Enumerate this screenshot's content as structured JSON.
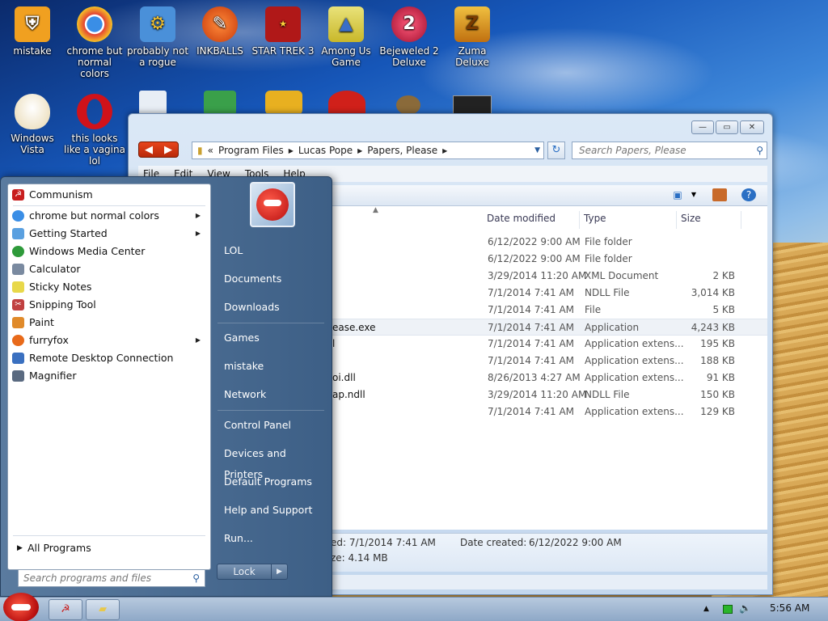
{
  "desktop": {
    "icons": [
      {
        "label": "mistake",
        "icon": "shield-folder-icon",
        "color": "#f0a020"
      },
      {
        "label": "chrome but normal colors",
        "icon": "chrome-icon",
        "color": "#3a8ee6"
      },
      {
        "label": "probably not a rogue",
        "icon": "gears-icon",
        "color": "#4a90d9"
      },
      {
        "label": "INKBALLS",
        "icon": "inkballs-icon",
        "color": "#e85a1a"
      },
      {
        "label": "STAR TREK 3",
        "icon": "star-wars-icon",
        "color": "#b01818"
      },
      {
        "label": "Among Us Game",
        "icon": "among-us-icon",
        "color": "#d9c22a"
      },
      {
        "label": "Bejeweled 2 Deluxe",
        "icon": "bejeweled-icon",
        "color": "#c81a3a"
      },
      {
        "label": "Zuma Deluxe",
        "icon": "zuma-icon",
        "color": "#e0a020"
      },
      {
        "label": "Windows Vista",
        "icon": "egg-icon",
        "color": "#f5f0e0"
      },
      {
        "label": "this looks like a vagina lol",
        "icon": "opera-icon",
        "color": "#d0121a"
      }
    ]
  },
  "explorer": {
    "breadcrumb": [
      "Program Files",
      "Lucas Pope",
      "Papers, Please"
    ],
    "breadcrumb_prefix": "«",
    "search_placeholder": "Search Papers, Please",
    "menu": [
      "File",
      "Edit",
      "View",
      "Tools",
      "Help"
    ],
    "columns": {
      "date": "Date modified",
      "type": "Type",
      "size": "Size"
    },
    "rows": [
      {
        "name": "",
        "date": "6/12/2022 9:00 AM",
        "type": "File folder",
        "size": ""
      },
      {
        "name": "",
        "date": "6/12/2022 9:00 AM",
        "type": "File folder",
        "size": ""
      },
      {
        "name": "",
        "date": "3/29/2014 11:20 AM",
        "type": "XML Document",
        "size": "2 KB"
      },
      {
        "name": "",
        "date": "7/1/2014 7:41 AM",
        "type": "NDLL File",
        "size": "3,014 KB"
      },
      {
        "name": "",
        "date": "7/1/2014 7:41 AM",
        "type": "File",
        "size": "5 KB"
      },
      {
        "name": "ease.exe",
        "date": "7/1/2014 7:41 AM",
        "type": "Application",
        "size": "4,243 KB"
      },
      {
        "name": "l",
        "date": "7/1/2014 7:41 AM",
        "type": "Application extens...",
        "size": "195 KB"
      },
      {
        "name": "",
        "date": "7/1/2014 7:41 AM",
        "type": "Application extens...",
        "size": "188 KB"
      },
      {
        "name": "oi.dll",
        "date": "8/26/2013 4:27 AM",
        "type": "Application extens...",
        "size": "91 KB"
      },
      {
        "name": "ap.ndll",
        "date": "3/29/2014 11:20 AM",
        "type": "NDLL File",
        "size": "150 KB"
      },
      {
        "name": "",
        "date": "7/1/2014 7:41 AM",
        "type": "Application extens...",
        "size": "129 KB"
      }
    ],
    "details": {
      "modified": "ed:  7/1/2014 7:41 AM",
      "created_label": "Date created:",
      "created_value": "6/12/2022 9:00 AM",
      "size": "ze:  4.14 MB"
    }
  },
  "start_menu": {
    "pinned": [
      {
        "label": "Communism",
        "color": "#c81e1e"
      }
    ],
    "programs": [
      {
        "label": "chrome but normal colors",
        "submenu": true,
        "color": "#3a8ee6"
      },
      {
        "label": "Getting Started",
        "submenu": true,
        "color": "#5aa0e0"
      },
      {
        "label": "Windows Media Center",
        "submenu": false,
        "color": "#2e9a3a"
      },
      {
        "label": "Calculator",
        "submenu": false,
        "color": "#7a8aa0"
      },
      {
        "label": "Sticky Notes",
        "submenu": false,
        "color": "#e8d84a"
      },
      {
        "label": "Snipping Tool",
        "submenu": false,
        "color": "#c04040"
      },
      {
        "label": "Paint",
        "submenu": false,
        "color": "#e08a2a"
      },
      {
        "label": "furryfox",
        "submenu": true,
        "color": "#e86a1a"
      },
      {
        "label": "Remote Desktop Connection",
        "submenu": false,
        "color": "#3a70c0"
      },
      {
        "label": "Magnifier",
        "submenu": false,
        "color": "#5a6a80"
      }
    ],
    "all_programs": "All Programs",
    "search_placeholder": "Search programs and files",
    "right_items": [
      "LOL",
      "Documents",
      "Downloads",
      "Games",
      "mistake",
      "Network",
      "Control Panel",
      "Devices and Printers",
      "Default Programs",
      "Help and Support",
      "Run..."
    ],
    "lock_label": "Lock"
  },
  "taskbar": {
    "clock": "5:56 AM",
    "buttons": [
      {
        "name": "communism",
        "color": "#c81e1e"
      },
      {
        "name": "explorer",
        "color": "#e8c84a"
      }
    ]
  }
}
